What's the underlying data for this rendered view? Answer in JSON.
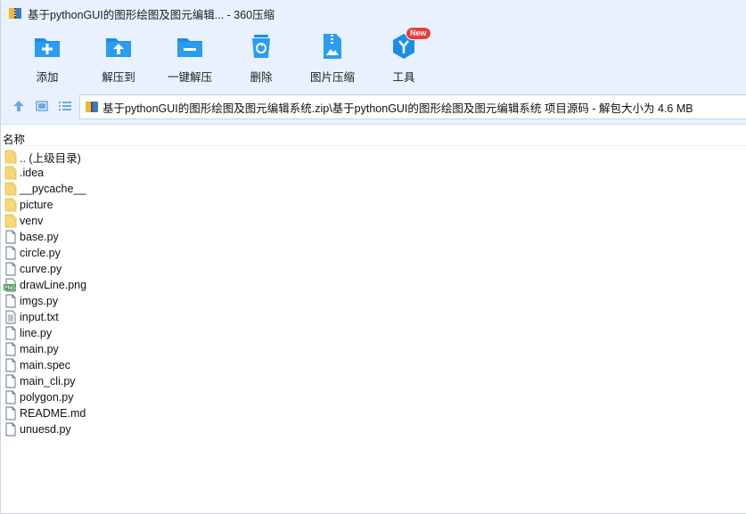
{
  "window": {
    "title": "基于pythonGUI的图形绘图及图元编辑... - 360压缩"
  },
  "toolbar": {
    "buttons": [
      {
        "label": "添加",
        "icon": "add-icon"
      },
      {
        "label": "解压到",
        "icon": "extract-to-icon"
      },
      {
        "label": "一键解压",
        "icon": "one-click-extract-icon"
      },
      {
        "label": "删除",
        "icon": "delete-icon"
      },
      {
        "label": "图片压缩",
        "icon": "image-compress-icon"
      },
      {
        "label": "工具",
        "icon": "tools-icon",
        "badge": "New"
      }
    ]
  },
  "address": {
    "path": "基于pythonGUI的图形绘图及图元编辑系统.zip\\基于pythonGUI的图形绘图及图元编辑系统 项目源码 - 解包大小为 4.6 MB"
  },
  "columns": {
    "name": "名称"
  },
  "files": [
    {
      "name": ".. (上级目录)",
      "type": "folder"
    },
    {
      "name": ".idea",
      "type": "folder"
    },
    {
      "name": "__pycache__",
      "type": "folder"
    },
    {
      "name": "picture",
      "type": "folder"
    },
    {
      "name": "venv",
      "type": "folder"
    },
    {
      "name": "base.py",
      "type": "file"
    },
    {
      "name": "circle.py",
      "type": "file"
    },
    {
      "name": "curve.py",
      "type": "file"
    },
    {
      "name": "drawLine.png",
      "type": "png"
    },
    {
      "name": "imgs.py",
      "type": "file"
    },
    {
      "name": "input.txt",
      "type": "text"
    },
    {
      "name": "line.py",
      "type": "file"
    },
    {
      "name": "main.py",
      "type": "file"
    },
    {
      "name": "main.spec",
      "type": "file"
    },
    {
      "name": "main_cli.py",
      "type": "file"
    },
    {
      "name": "polygon.py",
      "type": "file"
    },
    {
      "name": "README.md",
      "type": "file"
    },
    {
      "name": "unuesd.py",
      "type": "file"
    }
  ],
  "colors": {
    "accent": "#1a8ee6",
    "toolbar_bg": "#e8f1fd",
    "folder": "#f7d774",
    "badge": "#f03a3a"
  }
}
